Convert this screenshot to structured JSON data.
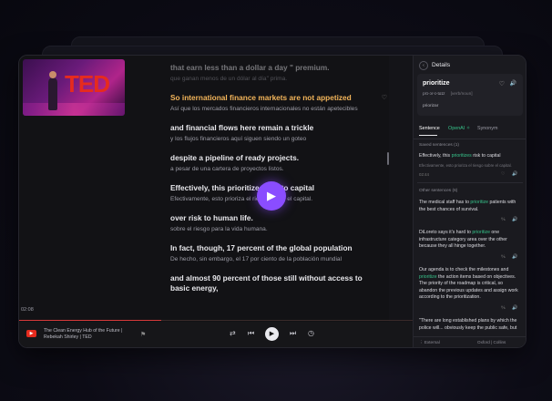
{
  "video": {
    "title": "The Clean Energy Hub of the Future | Rebekah Shirley | TED",
    "timecode": "02:08",
    "progress_fraction": 0.28,
    "logo_text": "TED"
  },
  "transcript": [
    {
      "en": "that earn less than a dollar a day \" premium.",
      "es": "que ganan menos de un dólar al día\" prima."
    },
    {
      "en": "So international finance markets are not appetized",
      "es": "Así que los mercados financieros internacionales no están apetecibles",
      "active": true
    },
    {
      "en": "and financial flows here remain a trickle",
      "es": "y los flujos financieros aquí siguen siendo un goteo"
    },
    {
      "en": "despite a pipeline of ready projects.",
      "es": "a pesar de una cartera de proyectos listos."
    },
    {
      "en": "Effectively, this prioritizes risk to capital",
      "es": "Efectivamente, esto prioriza el riesgo sobre el capital."
    },
    {
      "en": "over risk to human life.",
      "es": "sobre el riesgo para la vida humana."
    },
    {
      "en": "In fact, though, 17 percent of the global population",
      "es": "De hecho, sin embargo, el 17 por ciento de la población mundial"
    },
    {
      "en": "and almost 90 percent of those still without access to basic energy,",
      "es": ""
    }
  ],
  "details": {
    "title": "Details",
    "word": "prioritize",
    "pronunciation": "prɪ-ɔr-ɪ-tɑɪz",
    "pos": "[verb/noun]",
    "definition": "priorizar",
    "tabs": [
      {
        "label": "Sentence",
        "active": true
      },
      {
        "label": "OpenAI ✧",
        "active": false
      },
      {
        "label": "Synonym",
        "active": false
      }
    ],
    "saved_label": "Saved sentences (1)",
    "saved": {
      "pre": "Effectively, this ",
      "hl": "prioritizes",
      "post": " risk to capital",
      "translation": "Efectivamente, esto prioriza el riesgo sobre el capital.",
      "time": "02:44"
    },
    "other_label": "Other sentences (6)",
    "others": [
      {
        "pre": "The medical staff has to ",
        "hl": "prioritize",
        "post": " patients with the best chances of survival."
      },
      {
        "pre": "DiLoreto says it's hard to ",
        "hl": "prioritize",
        "post": " one infrastructure category area over the other because they all hinge together."
      },
      {
        "pre": "Our agenda is to check the milestones and ",
        "hl": "prioritize",
        "post": " the action items based on objectives. The priority of the roadmap is critical, so abandon the previous updates and assign work according to the prioritization."
      },
      {
        "pre": "\"There are long established plans by which the police will... obviously keep the public safe, but",
        "hl": "",
        "post": ""
      }
    ],
    "footer_external": "External",
    "footer_oxford": "Oxford",
    "footer_collins": "Collins"
  },
  "icons": {
    "play": "play-icon",
    "bookmark": "bookmark-icon",
    "repeat": "repeat-icon",
    "prev": "skip-back-icon",
    "next": "skip-forward-icon",
    "speed": "speed-icon",
    "speaker": "speaker-icon",
    "heart": "heart-icon",
    "translate": "translate-icon"
  },
  "colors": {
    "accent": "#8a4dff",
    "active_line": "#f3b55a",
    "highlight": "#37c38a",
    "brand_red": "#e62b1e"
  }
}
